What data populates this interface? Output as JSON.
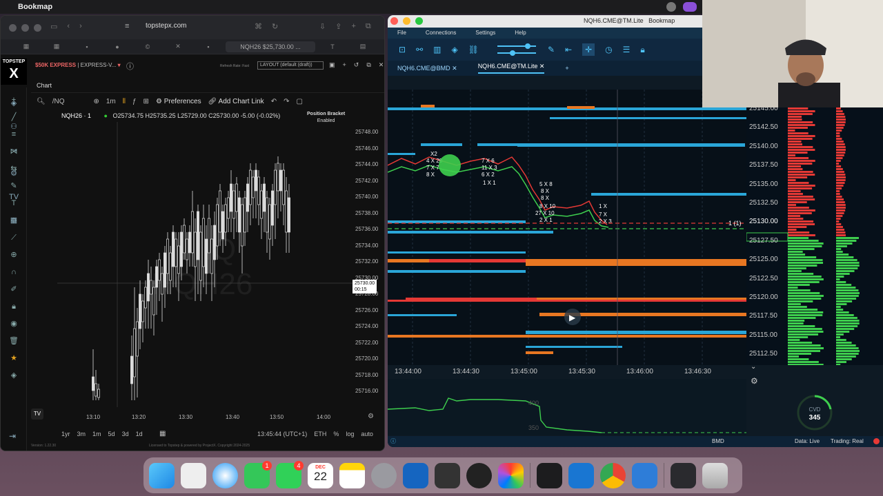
{
  "menubar": {
    "app_name": "Bookmap"
  },
  "browser": {
    "url": "topstepx.com",
    "active_tab": "NQH26 $25,730.00 ...",
    "logo_top": "TOPSTEP",
    "logo_main": "X",
    "account": "$50K EXPRESS",
    "account_suffix": "| EXPRESS-V...",
    "refresh_rate": "Refresh Rate: Fast",
    "layout": "LAYOUT (default (draft))",
    "chart_tab": "Chart",
    "symbol_search": "/NQ",
    "interval": "1m",
    "preferences": "Preferences",
    "add_chart_link": "Add Chart Link",
    "instrument": "NQH26 · 1",
    "ohlc": {
      "o": "O25734.75",
      "h": "H25735.25",
      "l": "L25729.00",
      "c": "C25730.00",
      "chg": "-5.00 (-0.02%)"
    },
    "position_bracket": "Position Bracket",
    "position_bracket_state": "Enabled",
    "watermark_1": "/NQ",
    "watermark_2": "NQH26",
    "price_label": "25730.00",
    "price_countdown": "00:15",
    "y_ticks": [
      "25748.00",
      "25746.00",
      "25744.00",
      "25742.00",
      "25740.00",
      "25738.00",
      "25736.00",
      "25734.00",
      "25732.00",
      "25730.00",
      "25728.00",
      "25726.00",
      "25724.00",
      "25722.00",
      "25720.00",
      "25718.00",
      "25716.00"
    ],
    "x_ticks": [
      "13:10",
      "13:20",
      "13:30",
      "13:40",
      "13:50",
      "14:00"
    ],
    "ranges": [
      "1yr",
      "3m",
      "1m",
      "5d",
      "3d",
      "1d"
    ],
    "clock": "13:45:44 (UTC+1)",
    "session": "ETH",
    "pct": "%",
    "log": "log",
    "auto": "auto",
    "license": "Licensed to Topstep & powered by ProjectX. Copyright 2024-2025",
    "version": "Version: 1.22.30"
  },
  "bookmap": {
    "title": "NQH6.CME@TM.Lite",
    "title_app": "Bookmap",
    "menu": [
      "File",
      "Connections",
      "Settings",
      "Help"
    ],
    "tabs": [
      "NQH6.CME@BMD",
      "NQH6.CME@TM.Lite"
    ],
    "prices": [
      "25145.00",
      "25142.50",
      "25140.00",
      "25137.50",
      "25135.00",
      "25132.50",
      "25130.00",
      "25127.50",
      "25125.00",
      "25122.50",
      "25120.00",
      "25117.50",
      "25115.00",
      "25112.50"
    ],
    "current_price_label": "25130.00",
    "position_marker": "1 (1)",
    "times": [
      "13:44:00",
      "13:44:30",
      "13:45:00",
      "13:45:30",
      "13:46:00",
      "13:46:30"
    ],
    "cvd_marks": [
      "400",
      "350"
    ],
    "cvd_label": "CVD",
    "cvd_value": "345",
    "status_bmd": "BMD",
    "status_data": "Data: Live",
    "status_trading": "Trading: Real",
    "trade_labels": [
      "X2",
      "4 X 20",
      "7 X 7",
      "8 X",
      "7 X 6",
      "11 X 3",
      "6 X 2",
      "1 X 1",
      "5 X 8",
      "8 X",
      "8 X",
      "8 X 10",
      "27 X 10",
      "2 X 1",
      "1 X",
      "7 X",
      "2 X 3"
    ]
  },
  "dock": {
    "calendar_month": "DEC",
    "calendar_day": "22",
    "messages_badge": "1",
    "facetime_badge": "4",
    "apps": [
      "finder",
      "launchpad",
      "safari",
      "messages",
      "facetime",
      "calendar",
      "notes",
      "system-settings",
      "sidebar-app",
      "unity",
      "activity-monitor",
      "photos",
      "terminal",
      "xcode",
      "chrome",
      "quicktime",
      "tv-app",
      "trash"
    ]
  }
}
